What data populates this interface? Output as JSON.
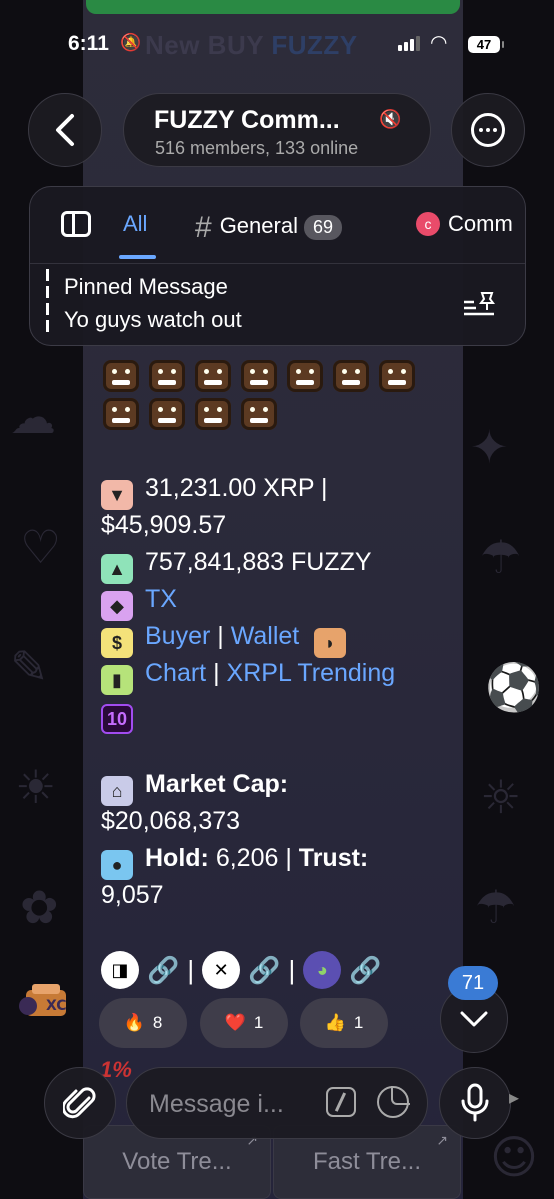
{
  "status_bar": {
    "time": "6:11",
    "battery": "47"
  },
  "behind_header": {
    "title_a": "New BUY",
    "title_b": "FUZZY"
  },
  "header": {
    "title": "FUZZY Comm...",
    "subtitle": "516 members, 133 online"
  },
  "topics": {
    "tabs": [
      {
        "label": "All",
        "active": true
      },
      {
        "label": "General",
        "count": "69"
      },
      {
        "label": "Comm",
        "icon_letter": "c"
      }
    ]
  },
  "pinned": {
    "title": "Pinned Message",
    "text": "Yo guys watch out"
  },
  "message": {
    "xrp_amount": "31,231.00 XRP |",
    "usd_amount": "$45,909.57",
    "fuzzy_amount": "757,841,883 FUZZY",
    "tx_link": "TX",
    "buyer_link": "Buyer",
    "wallet_link": "Wallet",
    "chart_link": "Chart",
    "trending_link": "XRPL Trending",
    "rank_badge": "10",
    "separator": "|",
    "market_cap_label": "Market Cap:",
    "market_cap_value": "$20,068,373",
    "hold_label": "Hold:",
    "hold_value": "6,206 |",
    "trust_label": "Trust:",
    "trust_value": "9,057"
  },
  "reactions": [
    {
      "emoji": "🔥",
      "count": "8"
    },
    {
      "emoji": "❤️",
      "count": "1"
    },
    {
      "emoji": "👍",
      "count": "1"
    }
  ],
  "inline_buttons": {
    "vote": "Vote Tre...",
    "fast": "Fast Tre..."
  },
  "scroll": {
    "unread_count": "71"
  },
  "composer": {
    "placeholder": "Message i..."
  },
  "colors": {
    "accent": "#6aa7ff",
    "badge_blue": "#3a7bd5",
    "bubble": "#2d2c3a"
  }
}
